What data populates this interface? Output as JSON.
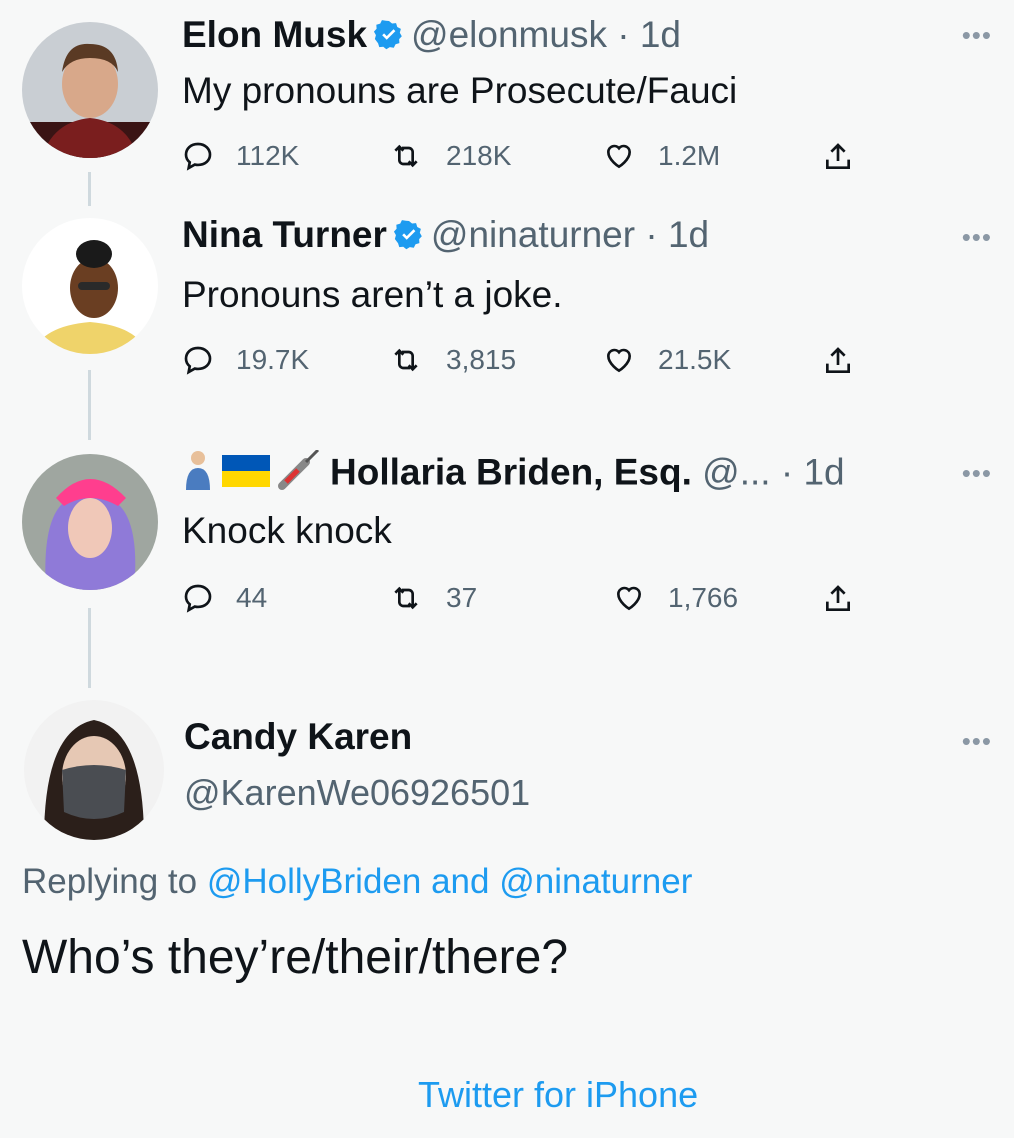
{
  "colors": {
    "accent": "#1d9bf0",
    "muted": "#536471",
    "text": "#0f1419",
    "background": "#f7f8f8"
  },
  "tweets": [
    {
      "name": "Elon Musk",
      "verified": true,
      "handle": "@elonmusk",
      "time": "· 1d",
      "text": "My pronouns are Prosecute/Fauci",
      "replies": "112K",
      "retweets": "218K",
      "likes": "1.2M"
    },
    {
      "name": "Nina Turner",
      "verified": true,
      "handle": "@ninaturner",
      "time": "· 1d",
      "text": "Pronouns aren’t a joke.",
      "replies": "19.7K",
      "retweets": "3,815",
      "likes": "21.5K"
    },
    {
      "name": "Hollaria Briden, Esq.",
      "verified": false,
      "handle": "@...",
      "time": "· 1d",
      "text": "Knock knock",
      "replies": "44",
      "retweets": "37",
      "likes": "1,766"
    }
  ],
  "main_tweet": {
    "name": "Candy Karen",
    "handle": "@KarenWe06926501",
    "replying_prefix": "Replying to",
    "replying_user1": "@HollyBriden",
    "replying_and": "and",
    "replying_user2": "@ninaturner",
    "text": "Who’s they’re/their/there?",
    "source": "Twitter for iPhone"
  },
  "icons": {
    "reply": "reply-icon",
    "retweet": "retweet-icon",
    "like": "heart-icon",
    "share": "share-icon",
    "more": "more-icon",
    "verified": "verified-badge-icon"
  }
}
